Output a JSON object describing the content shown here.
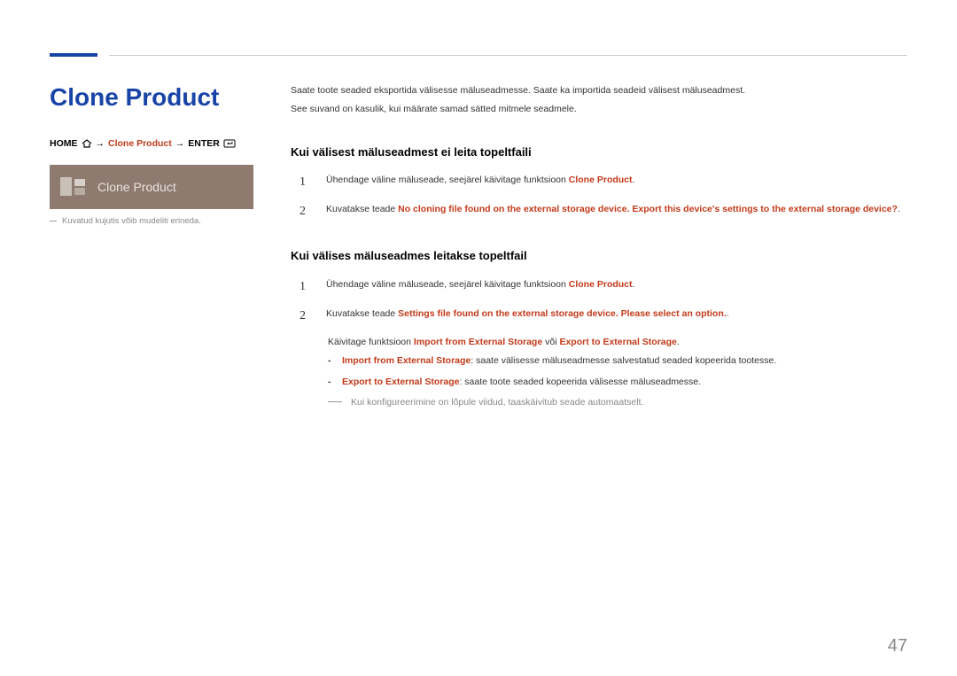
{
  "page_number": "47",
  "left": {
    "title": "Clone Product",
    "breadcrumb": {
      "home": "HOME",
      "item": "Clone Product",
      "enter": "ENTER",
      "arrow": "→"
    },
    "promo_label": "Clone Product",
    "caption": "Kuvatud kujutis võib mudeliti erineda."
  },
  "right": {
    "intro1": "Saate toote seaded eksportida välisesse mäluseadmesse. Saate ka importida seadeid välisest mäluseadmest.",
    "intro2": "See suvand on kasulik, kui määrate samad sätted mitmele seadmele.",
    "section1_title": "Kui välisest mäluseadmest ei leita topeltfaili",
    "s1_step1_a": "Ühendage väline mäluseade, seejärel käivitage funktsioon ",
    "s1_step1_b": "Clone Product",
    "s1_step1_c": ".",
    "s1_step2_a": "Kuvatakse teade ",
    "s1_step2_b": "No cloning file found on the external storage device. Export this device's settings to the external storage device?",
    "s1_step2_c": ".",
    "section2_title": "Kui välises mäluseadmes leitakse topeltfail",
    "s2_step1_a": "Ühendage väline mäluseade, seejärel käivitage funktsioon ",
    "s2_step1_b": "Clone Product",
    "s2_step1_c": ".",
    "s2_step2_a": "Kuvatakse teade ",
    "s2_step2_b": "Settings file found on the external storage device. Please select an option.",
    "s2_step2_c": ".",
    "s2_launch_a": "Käivitage funktsioon ",
    "s2_launch_b": "Import from External Storage",
    "s2_launch_c": " või ",
    "s2_launch_d": "Export to External Storage",
    "s2_launch_e": ".",
    "dash1_a": "Import from External Storage",
    "dash1_b": ": saate välisesse mäluseadmesse salvestatud seaded kopeerida tootesse.",
    "dash2_a": "Export to External Storage",
    "dash2_b": ": saate toote seaded kopeerida välisesse mäluseadmesse.",
    "note": "Kui konfigureerimine on lõpule viidud, taaskäivitub seade automaatselt."
  }
}
